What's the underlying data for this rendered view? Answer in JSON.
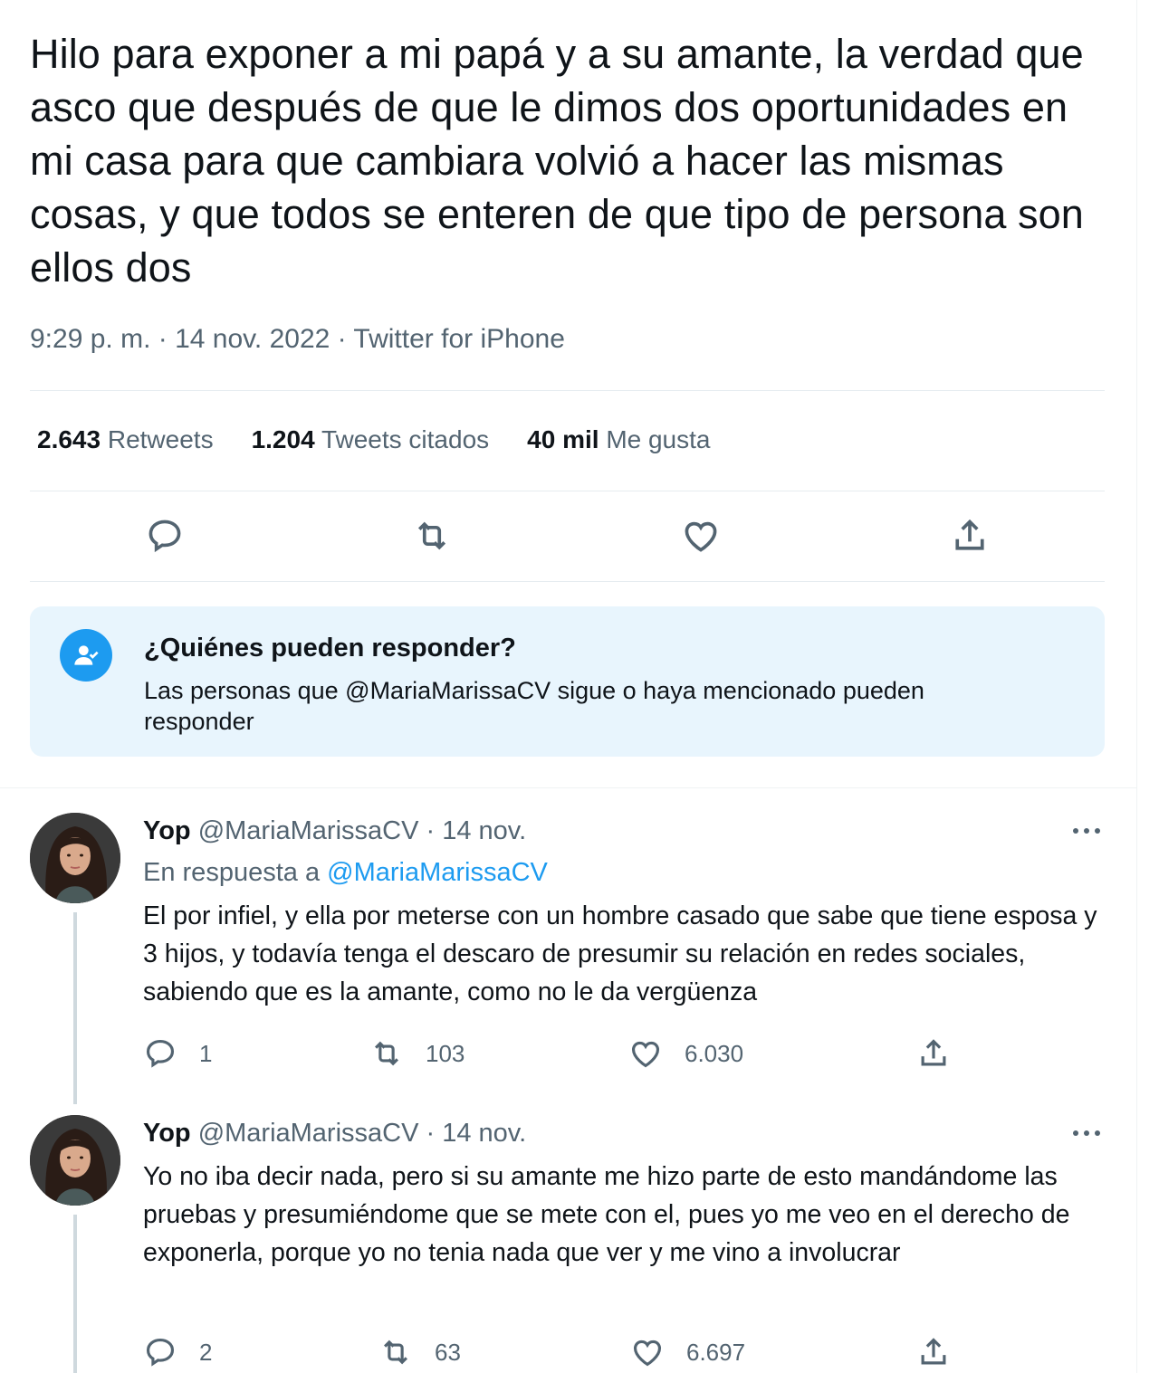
{
  "main_tweet": {
    "text": "Hilo para exponer a mi papá y a su amante, la verdad que asco que después de que le dimos dos oportunidades en mi casa para que cambiara volvió a hacer las mismas cosas, y que todos se enteren de que tipo de persona son ellos dos",
    "meta": "9:29 p. m. · 14 nov. 2022 · Twitter for iPhone",
    "stats": {
      "retweets_count": "2.643",
      "retweets_label": "Retweets",
      "quotes_count": "1.204",
      "quotes_label": "Tweets citados",
      "likes_count": "40 mil",
      "likes_label": "Me gusta"
    },
    "actions": [
      "reply-icon",
      "retweet-icon",
      "like-icon",
      "share-icon"
    ]
  },
  "reply_restriction": {
    "icon": "user-check-icon",
    "title": "¿Quiénes pueden responder?",
    "body": "Las personas que @MariaMarissaCV sigue o haya mencionado pueden responder"
  },
  "replies": [
    {
      "name": "Yop",
      "handle_date": "@MariaMarissaCV · 14 nov.",
      "replying_label": "En respuesta a",
      "replying_to": "@MariaMarissaCV",
      "text": "El por infiel, y ella por meterse con un hombre casado que sabe que tiene esposa y 3 hijos, y todavía tenga el descaro de presumir su relación en redes sociales, sabiendo que es la amante, como no le da vergüenza",
      "reply_count": "1",
      "retweet_count": "103",
      "like_count": "6.030"
    },
    {
      "name": "Yop",
      "handle_date": "@MariaMarissaCV · 14 nov.",
      "text": "Yo no iba decir nada, pero si su amante me hizo parte de esto mandándome las pruebas y presumiéndome que se mete con el, pues yo me veo en el derecho de exponerla, porque yo no tenia nada que ver y me vino a involucrar",
      "reply_count": "2",
      "retweet_count": "63",
      "like_count": "6.697"
    }
  ],
  "colors": {
    "text": "#0f1419",
    "secondary": "#536471",
    "accent": "#1d9bf0",
    "reply_box_bg": "#e8f5fd"
  }
}
